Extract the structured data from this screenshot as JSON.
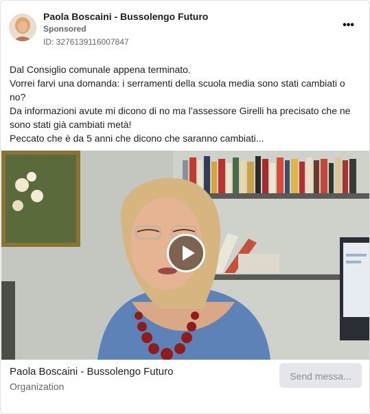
{
  "post": {
    "page_name": "Paola Boscaini - Bussolengo Futuro",
    "sponsored_label": "Sponsored",
    "ad_id": "ID: 3276139116007847",
    "more_icon": "more-options-icon",
    "body_lines": [
      "Dal Consiglio comunale appena terminato.",
      "Vorrei farvi una domanda: i serramenti della scuola media sono stati cambiati o no?",
      "Da informazioni avute mi dicono di no ma l’assessore Girelli ha precisato che ne sono stati già cambiati metà!",
      "Peccato che è da 5 anni che dicono che saranno cambiati..."
    ]
  },
  "video": {
    "play_icon": "play-icon"
  },
  "footer": {
    "title": "Paola Boscaini - Bussolengo Futuro",
    "subtitle": "Organization",
    "cta_label": "Send messa..."
  },
  "colors": {
    "secondary_text": "#65676b",
    "button_bg": "#e4e6eb",
    "border": "#dddfe2"
  }
}
